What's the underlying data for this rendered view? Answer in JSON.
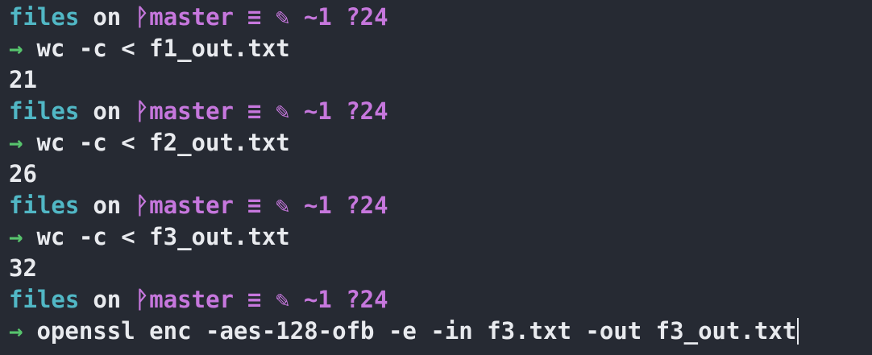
{
  "prompt": {
    "dir": "files",
    "on": "on",
    "branch_icon": "ᚹ",
    "branch": "master",
    "status": "≡ ✎ ~1 ?24"
  },
  "colors": {
    "background": "#262a33",
    "dir": "#51b7c5",
    "branch": "#c677dd",
    "arrow": "#57c46d",
    "text": "#e8eaee"
  },
  "arrow_symbol": "→",
  "commands": [
    {
      "cmd": "wc -c < f1_out.txt",
      "output": "21"
    },
    {
      "cmd": "wc -c < f2_out.txt",
      "output": "26"
    },
    {
      "cmd": "wc -c < f3_out.txt",
      "output": "32"
    },
    {
      "cmd": "openssl enc -aes-128-ofb -e -in f3.txt -out f3_out.txt",
      "output": ""
    }
  ]
}
